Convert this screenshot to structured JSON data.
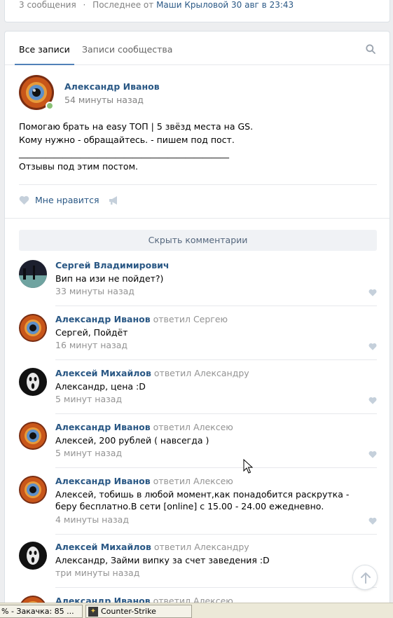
{
  "topline": {
    "count": "3 сообщения",
    "dot": "·",
    "last_from": "Последнее от",
    "last_author": "Маши Крыловой",
    "last_date": "30 авг в 23:43"
  },
  "tabs": [
    {
      "label": "Все записи",
      "active": true
    },
    {
      "label": "Записи сообщества",
      "active": false
    }
  ],
  "post": {
    "author": "Александр Иванов",
    "time": "54 минуты назад",
    "text": "Помогаю брать на easy ТОП | 5 звёзд места на GS.\nКому нужно - обращайтесь. - пишем под пост.\n________________________________________________\nОтзывы под этим постом.",
    "like_label": "Мне нравится"
  },
  "comments_block": {
    "hide_label": "Скрыть комментарии",
    "items": [
      {
        "author": "Сергей Владимирович",
        "reply": "",
        "text": "Вип на изи не пойдет?)",
        "time": "33 минуты назад",
        "avatar": "landscape"
      },
      {
        "author": "Александр Иванов",
        "reply": "ответил Сергею",
        "text": "Сергей, Пойдёт",
        "time": "16 минут назад",
        "avatar": "eye"
      },
      {
        "author": "Алексей Михайлов",
        "reply": "ответил Александру",
        "text": "Александр, цена :D",
        "time": "5 минут назад",
        "avatar": "scream"
      },
      {
        "author": "Александр Иванов",
        "reply": "ответил Алексею",
        "text": "Алексей, 200 рублей ( навсегда )",
        "time": "5 минут назад",
        "avatar": "eye"
      },
      {
        "author": "Александр Иванов",
        "reply": "ответил Алексею",
        "text": "Алексей, тобишь в любой момент,как понадобится раскрутка - беру бесплатно.В сети [online] с 15.00 - 24.00 ежедневно.",
        "time": "4 минуты назад",
        "avatar": "eye"
      },
      {
        "author": "Алексей Михайлов",
        "reply": "ответил Александру",
        "text": "Александр, Займи випку за счет заведения :D",
        "time": "три минуты назад",
        "avatar": "scream"
      },
      {
        "author": "Александр Иванов",
        "reply": "ответил Алексею",
        "text": "",
        "time": "",
        "avatar": "eye"
      }
    ]
  },
  "taskbar": {
    "task1": "% - Закачка: 85 ...",
    "task2": "Counter-Strike"
  },
  "colors": {
    "link": "#2a5885",
    "muted": "#828282",
    "accent": "#5181b8",
    "online": "#8ac176"
  },
  "icons": [
    "search-icon",
    "heart-icon",
    "megaphone-icon",
    "arrow-up-icon",
    "mouse-cursor-icon",
    "counter-strike-icon"
  ]
}
